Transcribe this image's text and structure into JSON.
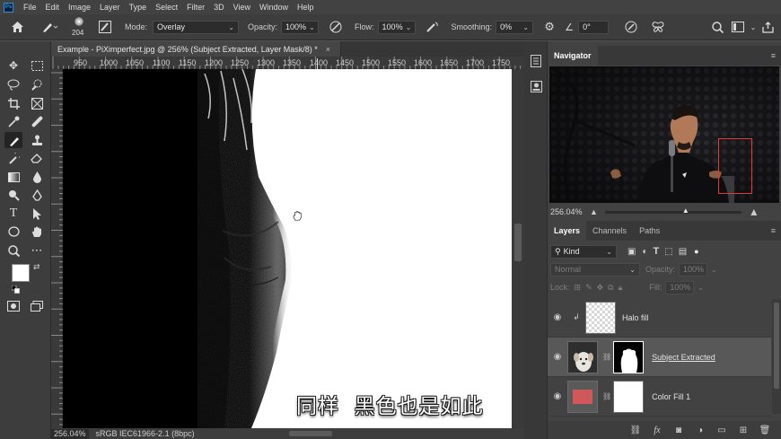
{
  "app": {
    "logo_text": "Ps"
  },
  "menu": [
    "File",
    "Edit",
    "Image",
    "Layer",
    "Type",
    "Select",
    "Filter",
    "3D",
    "View",
    "Window",
    "Help"
  ],
  "options": {
    "brush_size": "204",
    "mode_label": "Mode:",
    "mode_value": "Overlay",
    "opacity_label": "Opacity:",
    "opacity_value": "100%",
    "flow_label": "Flow:",
    "flow_value": "100%",
    "smoothing_label": "Smoothing:",
    "smoothing_value": "0%",
    "angle_value": "0°"
  },
  "document": {
    "tab_title": "Example - PiXimperfect.jpg @ 256% (Subject Extracted, Layer Mask/8) *",
    "close_glyph": "×",
    "ruler_ticks": [
      "950",
      "1000",
      "1050",
      "1100",
      "1150",
      "1200",
      "1250",
      "1300",
      "1350",
      "1400",
      "1450",
      "1500",
      "1550",
      "1600",
      "1650",
      "1700",
      "1750"
    ],
    "zoom": "256.04%",
    "color_profile": "sRGB IEC61966-2.1 (8bpc)"
  },
  "subtitle": "同样  黑色也是如此",
  "navigator": {
    "title": "Navigator",
    "zoom": "256.04%"
  },
  "layers_panel": {
    "tabs": [
      "Layers",
      "Channels",
      "Paths"
    ],
    "filter_kind": "Kind",
    "blend_mode": "Normal",
    "opacity_label": "Opacity:",
    "opacity_value": "100%",
    "lock_label": "Lock:",
    "fill_label": "Fill:",
    "fill_value": "100%",
    "layers": [
      {
        "name": "Halo fill"
      },
      {
        "name": "Subject Extracted"
      },
      {
        "name": "Color Fill 1"
      }
    ]
  },
  "colors": {
    "color_fill_swatch": "#d0575a",
    "ui_dark": "#3d3d3d",
    "canvas": "#ffffff"
  }
}
